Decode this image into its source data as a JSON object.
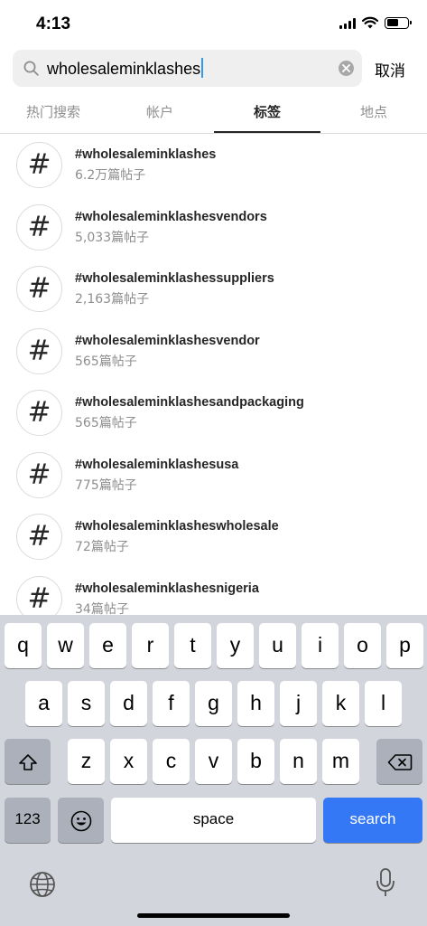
{
  "status_bar": {
    "time": "4:13"
  },
  "search": {
    "query": "wholesaleminklashes",
    "cancel_label": "取消"
  },
  "tabs": [
    {
      "label": "热门搜索",
      "active": false
    },
    {
      "label": "帐户",
      "active": false
    },
    {
      "label": "标签",
      "active": true
    },
    {
      "label": "地点",
      "active": false
    }
  ],
  "results": [
    {
      "icon": "#",
      "name": "#wholesaleminklashes",
      "count": "6.2万篇帖子"
    },
    {
      "icon": "#",
      "name": "#wholesaleminklashesvendors",
      "count": "5,033篇帖子"
    },
    {
      "icon": "#",
      "name": "#wholesaleminklashessuppliers",
      "count": "2,163篇帖子"
    },
    {
      "icon": "#",
      "name": "#wholesaleminklashesvendor",
      "count": "565篇帖子"
    },
    {
      "icon": "#",
      "name": "#wholesaleminklashesandpackaging",
      "count": "565篇帖子"
    },
    {
      "icon": "#",
      "name": "#wholesaleminklashesusa",
      "count": "775篇帖子"
    },
    {
      "icon": "#",
      "name": "#wholesaleminklasheswholesale",
      "count": "72篇帖子"
    },
    {
      "icon": "#",
      "name": "#wholesaleminklashesnigeria",
      "count": "34篇帖子"
    }
  ],
  "keyboard": {
    "row1": [
      "q",
      "w",
      "e",
      "r",
      "t",
      "y",
      "u",
      "i",
      "o",
      "p"
    ],
    "row2": [
      "a",
      "s",
      "d",
      "f",
      "g",
      "h",
      "j",
      "k",
      "l"
    ],
    "row3": [
      "z",
      "x",
      "c",
      "v",
      "b",
      "n",
      "m"
    ],
    "numbers_label": "123",
    "space_label": "space",
    "search_label": "search"
  },
  "colors": {
    "accent": "#3797f0",
    "search_key": "#3478f6",
    "keyboard_bg": "#d2d5db",
    "muted_text": "#8e8e8e"
  }
}
